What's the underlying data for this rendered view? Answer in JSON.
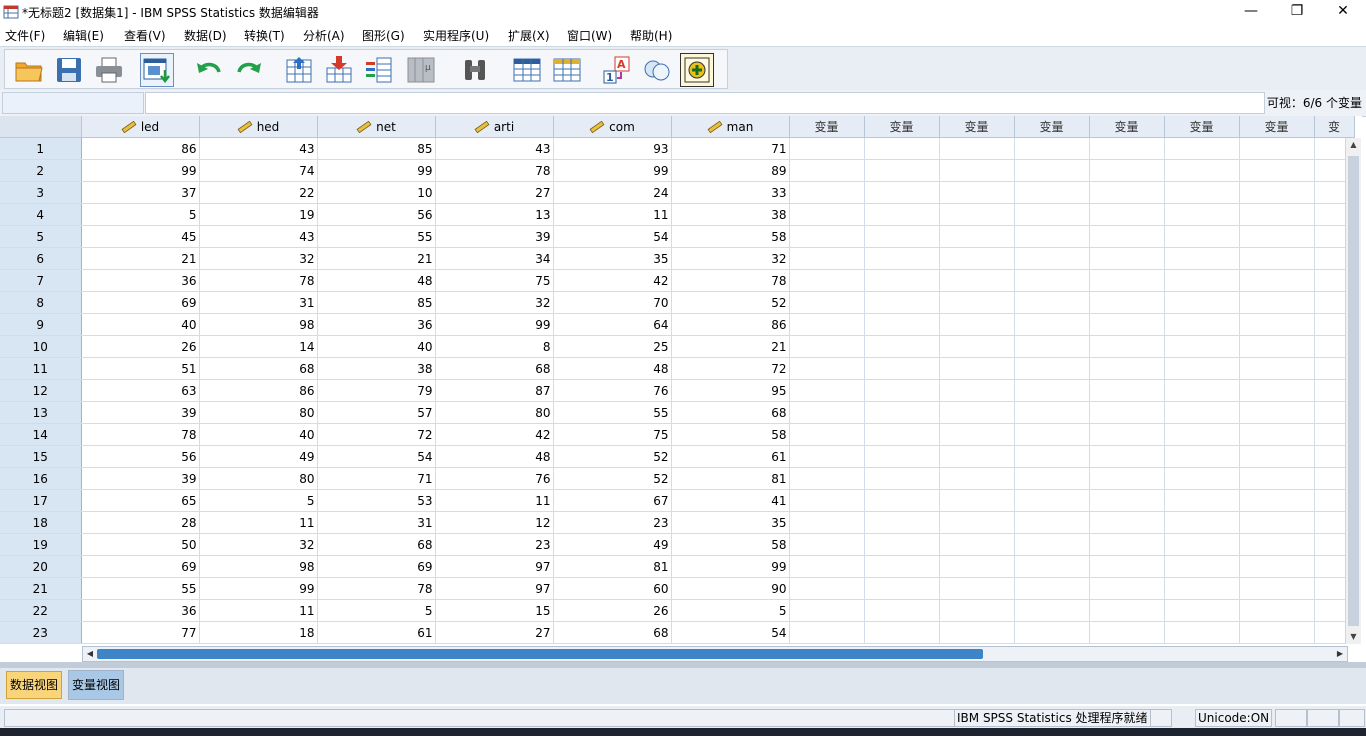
{
  "window": {
    "title": "*无标题2 [数据集1] - IBM SPSS Statistics 数据编辑器",
    "minimize": "—",
    "restore": "❐",
    "close": "✕"
  },
  "menu": [
    "文件(F)",
    "编辑(E)",
    "查看(V)",
    "数据(D)",
    "转换(T)",
    "分析(A)",
    "图形(G)",
    "实用程序(U)",
    "扩展(X)",
    "窗口(W)",
    "帮助(H)"
  ],
  "toolbar": {
    "buttons": [
      "open-icon",
      "save-icon",
      "print-icon",
      "recall-dialog-icon",
      "undo-icon",
      "redo-icon",
      "go-to-case-icon",
      "go-to-variable-icon",
      "variables-icon",
      "run-descriptives-icon",
      "find-icon",
      "insert-cases-icon",
      "insert-variable-icon",
      "split-file-icon",
      "weight-cases-icon",
      "select-cases-icon",
      "value-labels-icon",
      "use-variable-sets-icon"
    ]
  },
  "editbar": {
    "cell_ref": "",
    "cell_value": "",
    "visible_count": "可视：6/6 个变量"
  },
  "grid": {
    "columns": [
      "led",
      "hed",
      "net",
      "arti",
      "com",
      "man"
    ],
    "empty_column_label": "变量",
    "empty_columns": [
      "变量",
      "变量",
      "变量",
      "变量",
      "变量",
      "变量",
      "变量",
      "变"
    ],
    "rows": [
      {
        "n": "1",
        "v": [
          "86",
          "43",
          "85",
          "43",
          "93",
          "71"
        ]
      },
      {
        "n": "2",
        "v": [
          "99",
          "74",
          "99",
          "78",
          "99",
          "89"
        ]
      },
      {
        "n": "3",
        "v": [
          "37",
          "22",
          "10",
          "27",
          "24",
          "33"
        ]
      },
      {
        "n": "4",
        "v": [
          "5",
          "19",
          "56",
          "13",
          "11",
          "38"
        ]
      },
      {
        "n": "5",
        "v": [
          "45",
          "43",
          "55",
          "39",
          "54",
          "58"
        ]
      },
      {
        "n": "6",
        "v": [
          "21",
          "32",
          "21",
          "34",
          "35",
          "32"
        ]
      },
      {
        "n": "7",
        "v": [
          "36",
          "78",
          "48",
          "75",
          "42",
          "78"
        ]
      },
      {
        "n": "8",
        "v": [
          "69",
          "31",
          "85",
          "32",
          "70",
          "52"
        ]
      },
      {
        "n": "9",
        "v": [
          "40",
          "98",
          "36",
          "99",
          "64",
          "86"
        ]
      },
      {
        "n": "10",
        "v": [
          "26",
          "14",
          "40",
          "8",
          "25",
          "21"
        ]
      },
      {
        "n": "11",
        "v": [
          "51",
          "68",
          "38",
          "68",
          "48",
          "72"
        ]
      },
      {
        "n": "12",
        "v": [
          "63",
          "86",
          "79",
          "87",
          "76",
          "95"
        ]
      },
      {
        "n": "13",
        "v": [
          "39",
          "80",
          "57",
          "80",
          "55",
          "68"
        ]
      },
      {
        "n": "14",
        "v": [
          "78",
          "40",
          "72",
          "42",
          "75",
          "58"
        ]
      },
      {
        "n": "15",
        "v": [
          "56",
          "49",
          "54",
          "48",
          "52",
          "61"
        ]
      },
      {
        "n": "16",
        "v": [
          "39",
          "80",
          "71",
          "76",
          "52",
          "81"
        ]
      },
      {
        "n": "17",
        "v": [
          "65",
          "5",
          "53",
          "11",
          "67",
          "41"
        ]
      },
      {
        "n": "18",
        "v": [
          "28",
          "11",
          "31",
          "12",
          "23",
          "35"
        ]
      },
      {
        "n": "19",
        "v": [
          "50",
          "32",
          "68",
          "23",
          "49",
          "58"
        ]
      },
      {
        "n": "20",
        "v": [
          "69",
          "98",
          "69",
          "97",
          "81",
          "99"
        ]
      },
      {
        "n": "21",
        "v": [
          "55",
          "99",
          "78",
          "97",
          "60",
          "90"
        ]
      },
      {
        "n": "22",
        "v": [
          "36",
          "11",
          "5",
          "15",
          "26",
          "5"
        ]
      },
      {
        "n": "23",
        "v": [
          "77",
          "18",
          "61",
          "27",
          "68",
          "54"
        ]
      }
    ]
  },
  "tabs": {
    "data_view": "数据视图",
    "variable_view": "变量视图"
  },
  "status": {
    "processor": "IBM SPSS Statistics 处理程序就绪",
    "unicode": "Unicode:ON"
  },
  "colors": {
    "accent": "#3d84c9",
    "row_header": "#d8e5f3",
    "active_tab": "#f8d47a",
    "inactive_tab": "#a9c8e6"
  }
}
